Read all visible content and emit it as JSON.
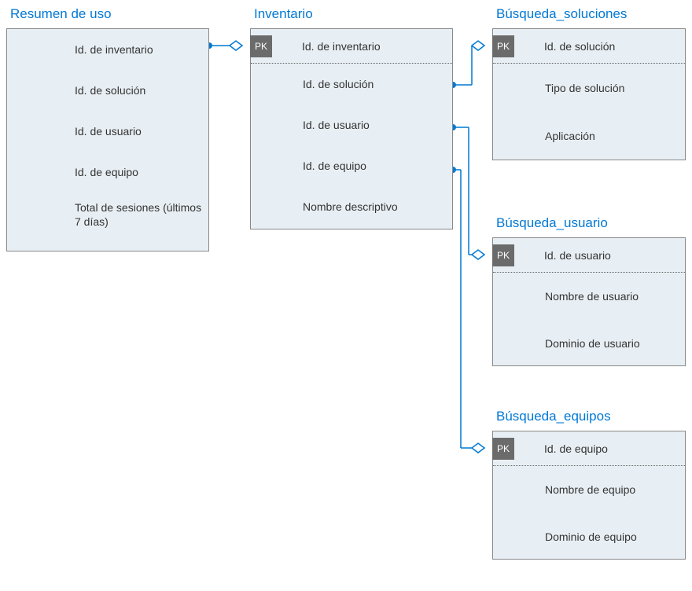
{
  "resumen": {
    "title": "Resumen de uso",
    "fields": [
      "Id. de inventario",
      "Id. de solución",
      "Id. de usuario",
      "Id. de equipo",
      "Total de sesiones (últimos 7 días)"
    ]
  },
  "inventario": {
    "title": "Inventario",
    "pk_badge": "PK",
    "pk_field": "Id. de inventario",
    "fields": [
      "Id. de solución",
      "Id. de usuario",
      "Id. de equipo",
      "Nombre descriptivo"
    ]
  },
  "soluciones": {
    "title": "Búsqueda_soluciones",
    "pk_badge": "PK",
    "pk_field": "Id. de solución",
    "fields": [
      "Tipo de solución",
      "Aplicación"
    ]
  },
  "usuario": {
    "title": "Búsqueda_usuario",
    "pk_badge": "PK",
    "pk_field": "Id. de usuario",
    "fields": [
      "Nombre de usuario",
      "Dominio de usuario"
    ]
  },
  "equipos": {
    "title": "Búsqueda_equipos",
    "pk_badge": "PK",
    "pk_field": "Id. de equipo",
    "fields": [
      "Nombre de equipo",
      "Dominio de equipo"
    ]
  }
}
